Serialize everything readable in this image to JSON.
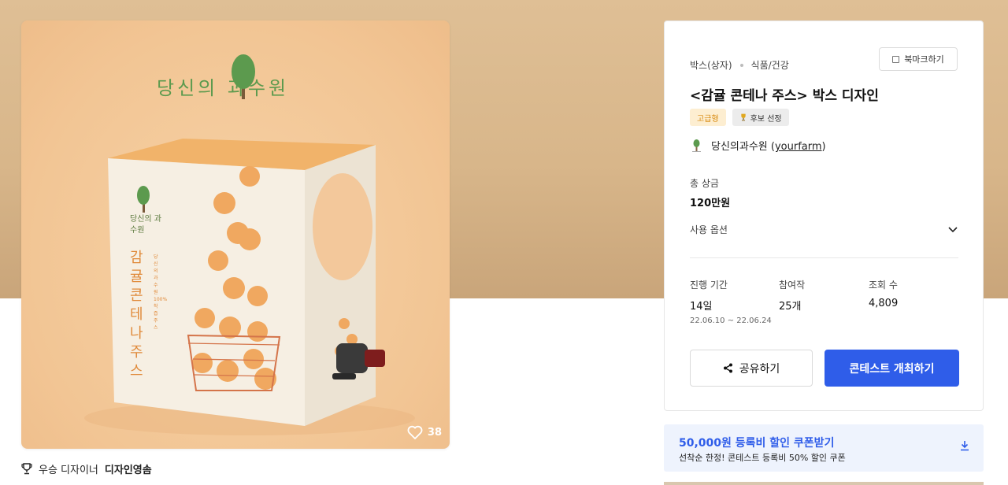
{
  "product_image": {
    "brand_title": "당신의 과수원",
    "box_front_brand": "당신의 과수원",
    "box_front_title": "감귤 콘테나 주스",
    "box_front_sub": "당신의과수원 100% 착즙 주스",
    "like_count": "38"
  },
  "winner": {
    "label": "우승 디자이너",
    "name": "디자인영솜"
  },
  "panel": {
    "bookmark_label": "북마크하기",
    "categories": [
      "박스(상자)",
      "식품/건강"
    ],
    "title": "<감귤 콘테나 주스> 박스 디자인",
    "badges": {
      "premium": "고급형",
      "pick": "후보 선정"
    },
    "owner_name": "당신의과수원",
    "owner_handle": "yourfarm",
    "prize_label": "총 상금",
    "prize_value": "120만원",
    "usage_label": "사용 옵션",
    "stats": [
      {
        "label": "진행 기간",
        "value": "14일"
      },
      {
        "label": "참여작",
        "value": "25개"
      },
      {
        "label": "조회 수",
        "value": "4,809"
      }
    ],
    "period_range": "22.06.10 ~ 22.06.24",
    "share_label": "공유하기",
    "host_label": "콘테스트 개최하기"
  },
  "coupon": {
    "title": "50,000원 등록비 할인 쿠폰받기",
    "subtitle": "선착순 한정! 콘테스트 등록비 50% 할인 쿠폰"
  },
  "colors": {
    "accent": "#2f5de9",
    "hero_bg": "#d8b68a",
    "image_bg": "#f2c594",
    "premium_badge_text": "#d88a10"
  }
}
